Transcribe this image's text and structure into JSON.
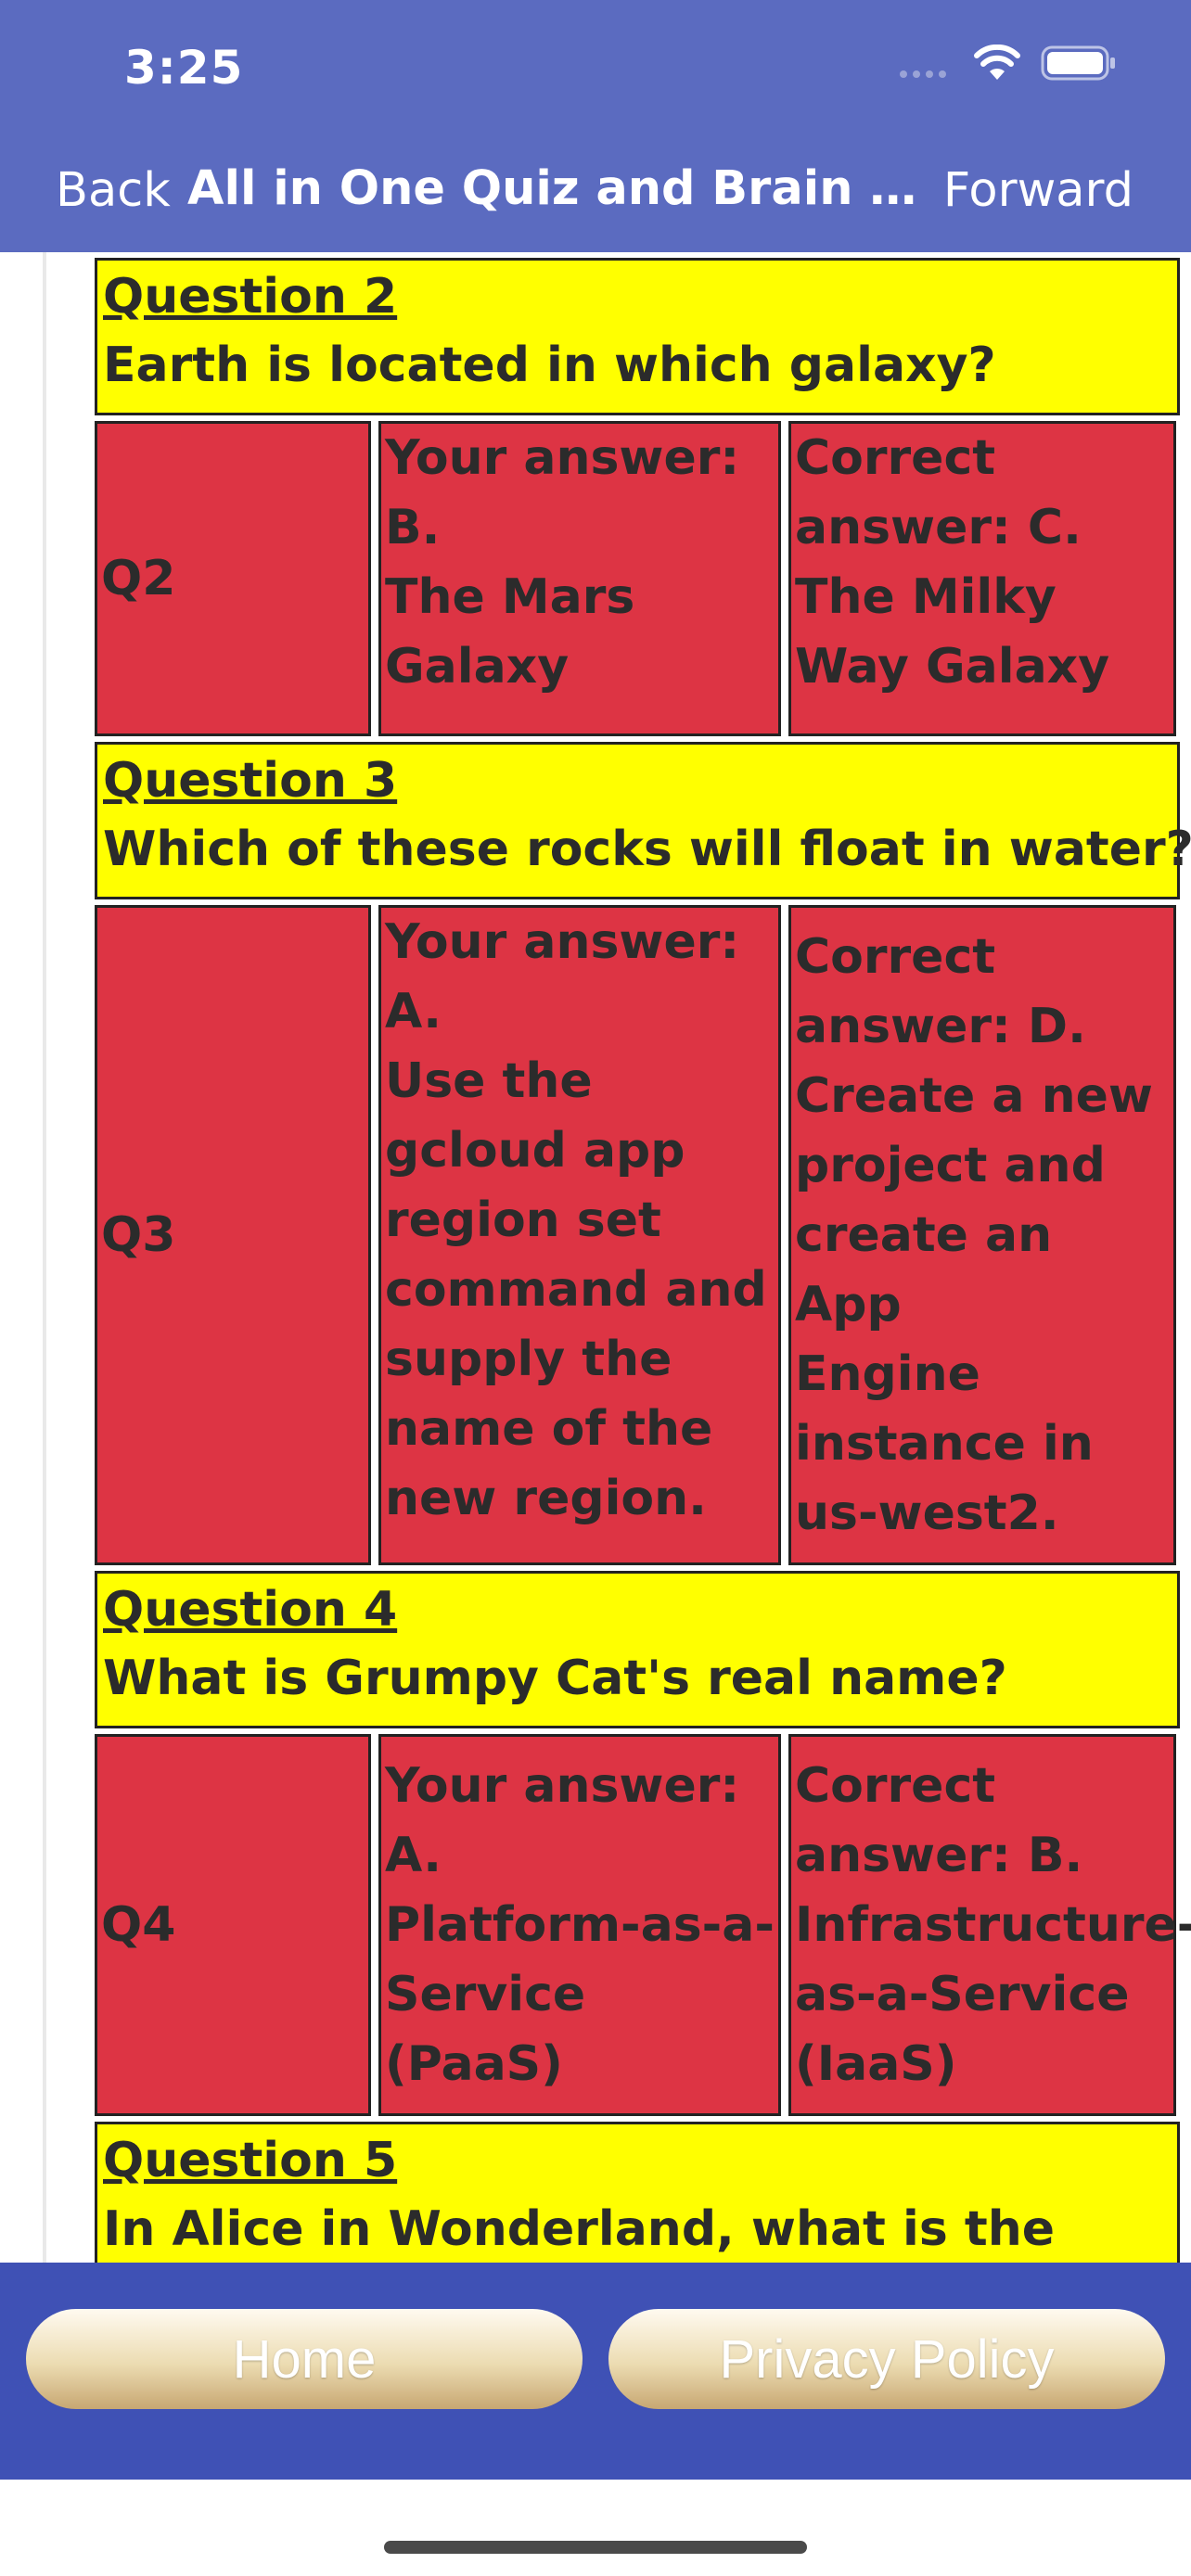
{
  "status_bar": {
    "time": "3:25"
  },
  "nav": {
    "back": "Back",
    "title": "All in One Quiz and Brain Teaser...",
    "forward": "Forward"
  },
  "quiz": {
    "questions": [
      {
        "label": "Question 2",
        "text": "Earth is located in which galaxy?",
        "id": "Q2",
        "your_answer_lines": [
          "Your answer:",
          "B.",
          "The Mars",
          "Galaxy"
        ],
        "correct_answer_lines": [
          "Correct",
          "answer: C.",
          "The Milky",
          "Way Galaxy"
        ]
      },
      {
        "label": "Question 3",
        "text": "Which of these rocks will float in water?",
        "id": "Q3",
        "your_answer_lines": [
          "Your answer:",
          "A.",
          "Use the",
          "gcloud app",
          "region set",
          "command and",
          "supply the",
          "name of the",
          "new region."
        ],
        "correct_answer_lines": [
          "Correct",
          "answer: D.",
          "Create a new",
          "project and",
          "create an App",
          "Engine",
          "instance in",
          "us-west2."
        ]
      },
      {
        "label": "Question 4",
        "text": "What is Grumpy Cat's real name?",
        "id": "Q4",
        "your_answer_lines": [
          "Your answer:",
          "A.",
          "Platform-as-a-",
          "Service (PaaS)"
        ],
        "correct_answer_lines": [
          "Correct",
          "answer: B.",
          "Infrastructure-",
          "as-a-Service",
          "(IaaS)"
        ]
      },
      {
        "label": "Question 5",
        "text": "In Alice in Wonderland, what is the"
      }
    ]
  },
  "toolbar": {
    "home": "Home",
    "privacy": "Privacy Policy"
  },
  "colors": {
    "nav_bg": "#5b6bc0",
    "toolbar_bg": "#3f51b5",
    "question_bg": "#ffff00",
    "answer_bg": "#dd3444"
  },
  "icons": [
    "cellular-signal-icon",
    "wifi-icon",
    "battery-icon"
  ]
}
